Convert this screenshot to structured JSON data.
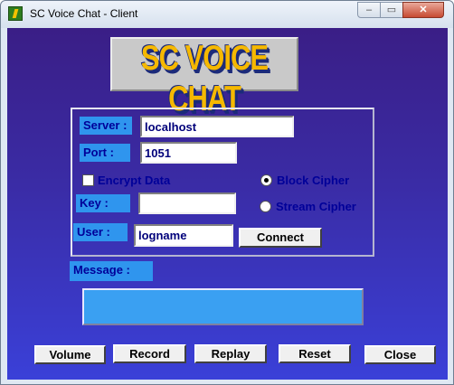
{
  "window": {
    "title": "SC Voice Chat - Client",
    "min_glyph": "–",
    "max_glyph": "▭",
    "close_glyph": "✕"
  },
  "logo": {
    "text": "SC VOICE CHAT"
  },
  "connection": {
    "server_label": "Server :",
    "server_value": "localhost",
    "port_label": "Port :",
    "port_value": "1051",
    "encrypt_label": "Encrypt Data",
    "encrypt_checked": false,
    "key_label": "Key :",
    "key_value": "",
    "block_cipher_label": "Block Cipher",
    "stream_cipher_label": "Stream Cipher",
    "selected_cipher": "Block Cipher",
    "user_label": "User :",
    "user_value": "logname",
    "connect_label": "Connect"
  },
  "message": {
    "label": "Message  :",
    "value": ""
  },
  "buttons": {
    "volume": "Volume",
    "record": "Record",
    "replay": "Replay",
    "reset": "Reset",
    "close": "Close"
  },
  "colors": {
    "background_top": "#3a1e86",
    "background_bottom": "#3a40d8",
    "label_bg": "#2f95ee",
    "label_text": "#000099",
    "logo_yellow": "#f5b800"
  }
}
